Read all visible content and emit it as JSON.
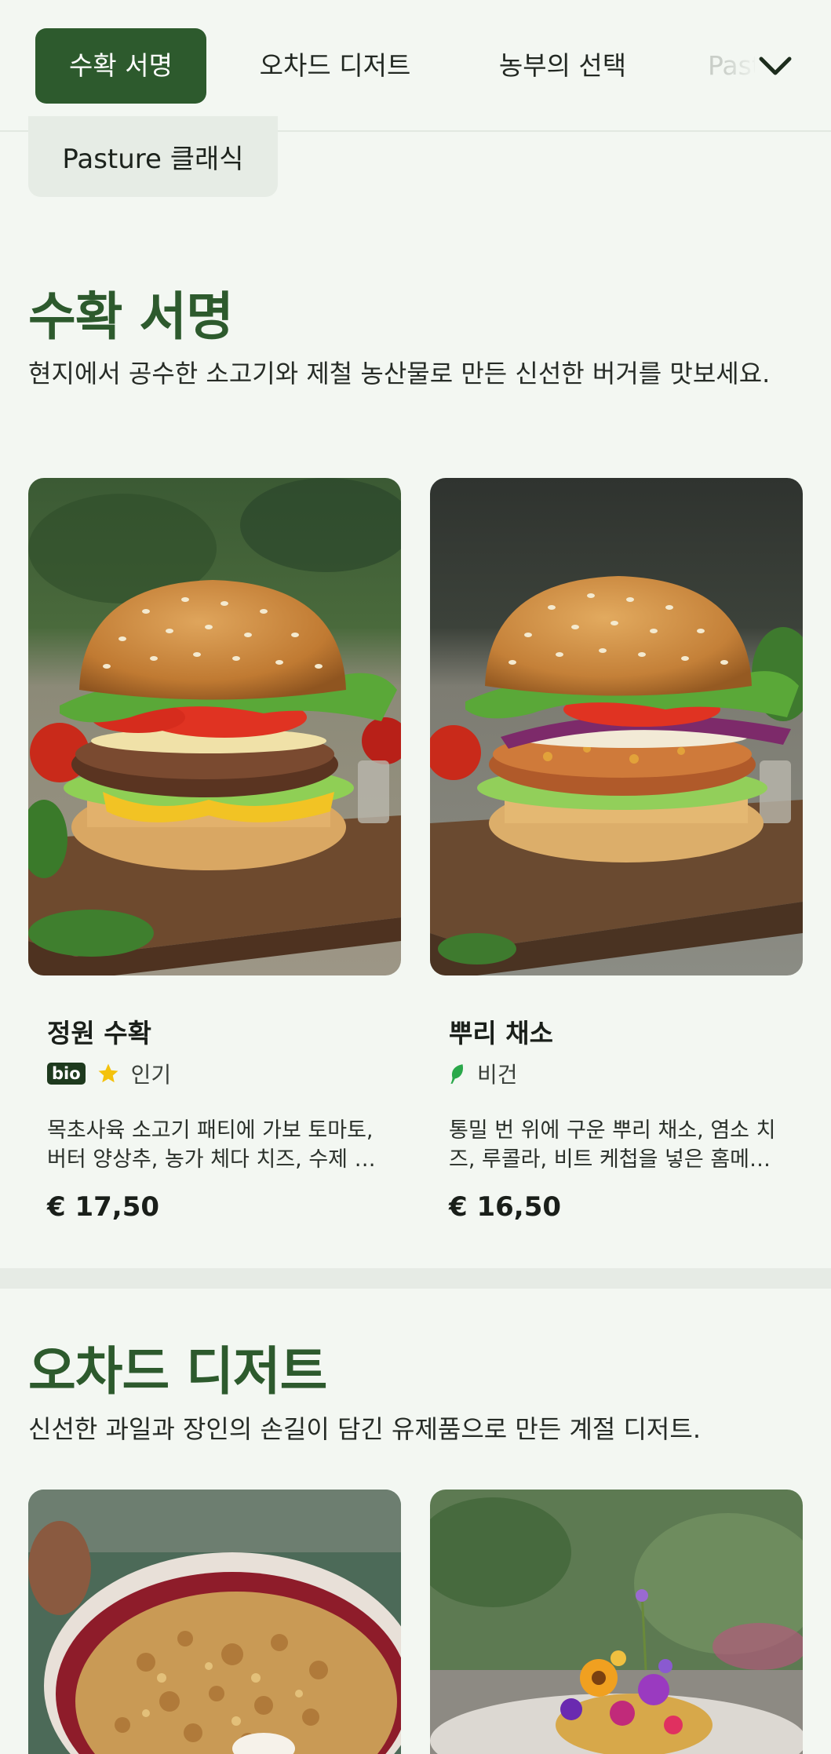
{
  "tabs": [
    {
      "label": "수확 서명",
      "active": true
    },
    {
      "label": "오차드 디저트",
      "active": false
    },
    {
      "label": "농부의 선택",
      "active": false
    },
    {
      "label": "Pasture 클래식",
      "active": false
    }
  ],
  "chip": {
    "label": "Pasture 클래식"
  },
  "sections": [
    {
      "title": "수확 서명",
      "description": "현지에서 공수한 소고기와 제철 농산물로 만든 신선한 버거를 맛보세요.",
      "items": [
        {
          "name": "정원 수확",
          "badge": "bio",
          "tag": "인기",
          "tag_icon": "star-icon",
          "description": "목초사육 소고기 패티에 가보 토마토, 버터 양상추, 농가 체다 치즈, 수제 소스를 더했습니다.",
          "price": "€ 17,50"
        },
        {
          "name": "뿌리 채소",
          "tag": "비건",
          "tag_icon": "leaf-icon",
          "description": "통밀 번 위에 구운 뿌리 채소, 염소 치즈, 루콜라, 비트 케첩을 넣은 홈메이드 패티.",
          "price": "€ 16,50"
        }
      ]
    },
    {
      "title": "오차드 디저트",
      "description": "신선한 과일과 장인의 손길이 담긴 유제품으로 만든 계절 디저트."
    }
  ],
  "colors": {
    "accent": "#2d5a2d",
    "background": "#f3f7f2",
    "star": "#f4c20d",
    "leaf": "#2aa84a"
  }
}
